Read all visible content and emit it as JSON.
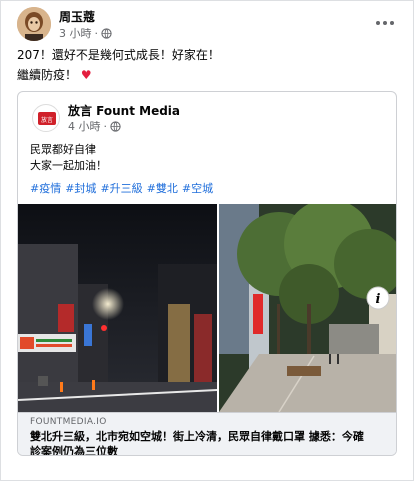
{
  "post": {
    "author": "周玉蔻",
    "time": "3 小時",
    "text_line1": "207！還好不是幾何式成長！好家在！",
    "text_line2": "繼續防疫！",
    "heart": "♥"
  },
  "shared": {
    "author": "放言 Fount Media",
    "time": "4 小時",
    "logo_text": "放言",
    "text_line1": "民眾都好自律",
    "text_line2": "大家一起加油！",
    "tags": [
      "#疫情",
      "#封城",
      "#升三級",
      "#雙北",
      "#空城"
    ]
  },
  "link": {
    "domain": "FOUNTMEDIA.IO",
    "title": "雙北升三級，北市宛如空城！街上冷清，民眾自律戴口罩 據悉：今確診案例仍為三位數"
  },
  "icons": {
    "globe": "globe-icon",
    "more": "more-options-icon",
    "info": "info-icon"
  },
  "colors": {
    "link_blue": "#216fdb",
    "heart_red": "#e41e3f",
    "meta_gray": "#65676b"
  }
}
